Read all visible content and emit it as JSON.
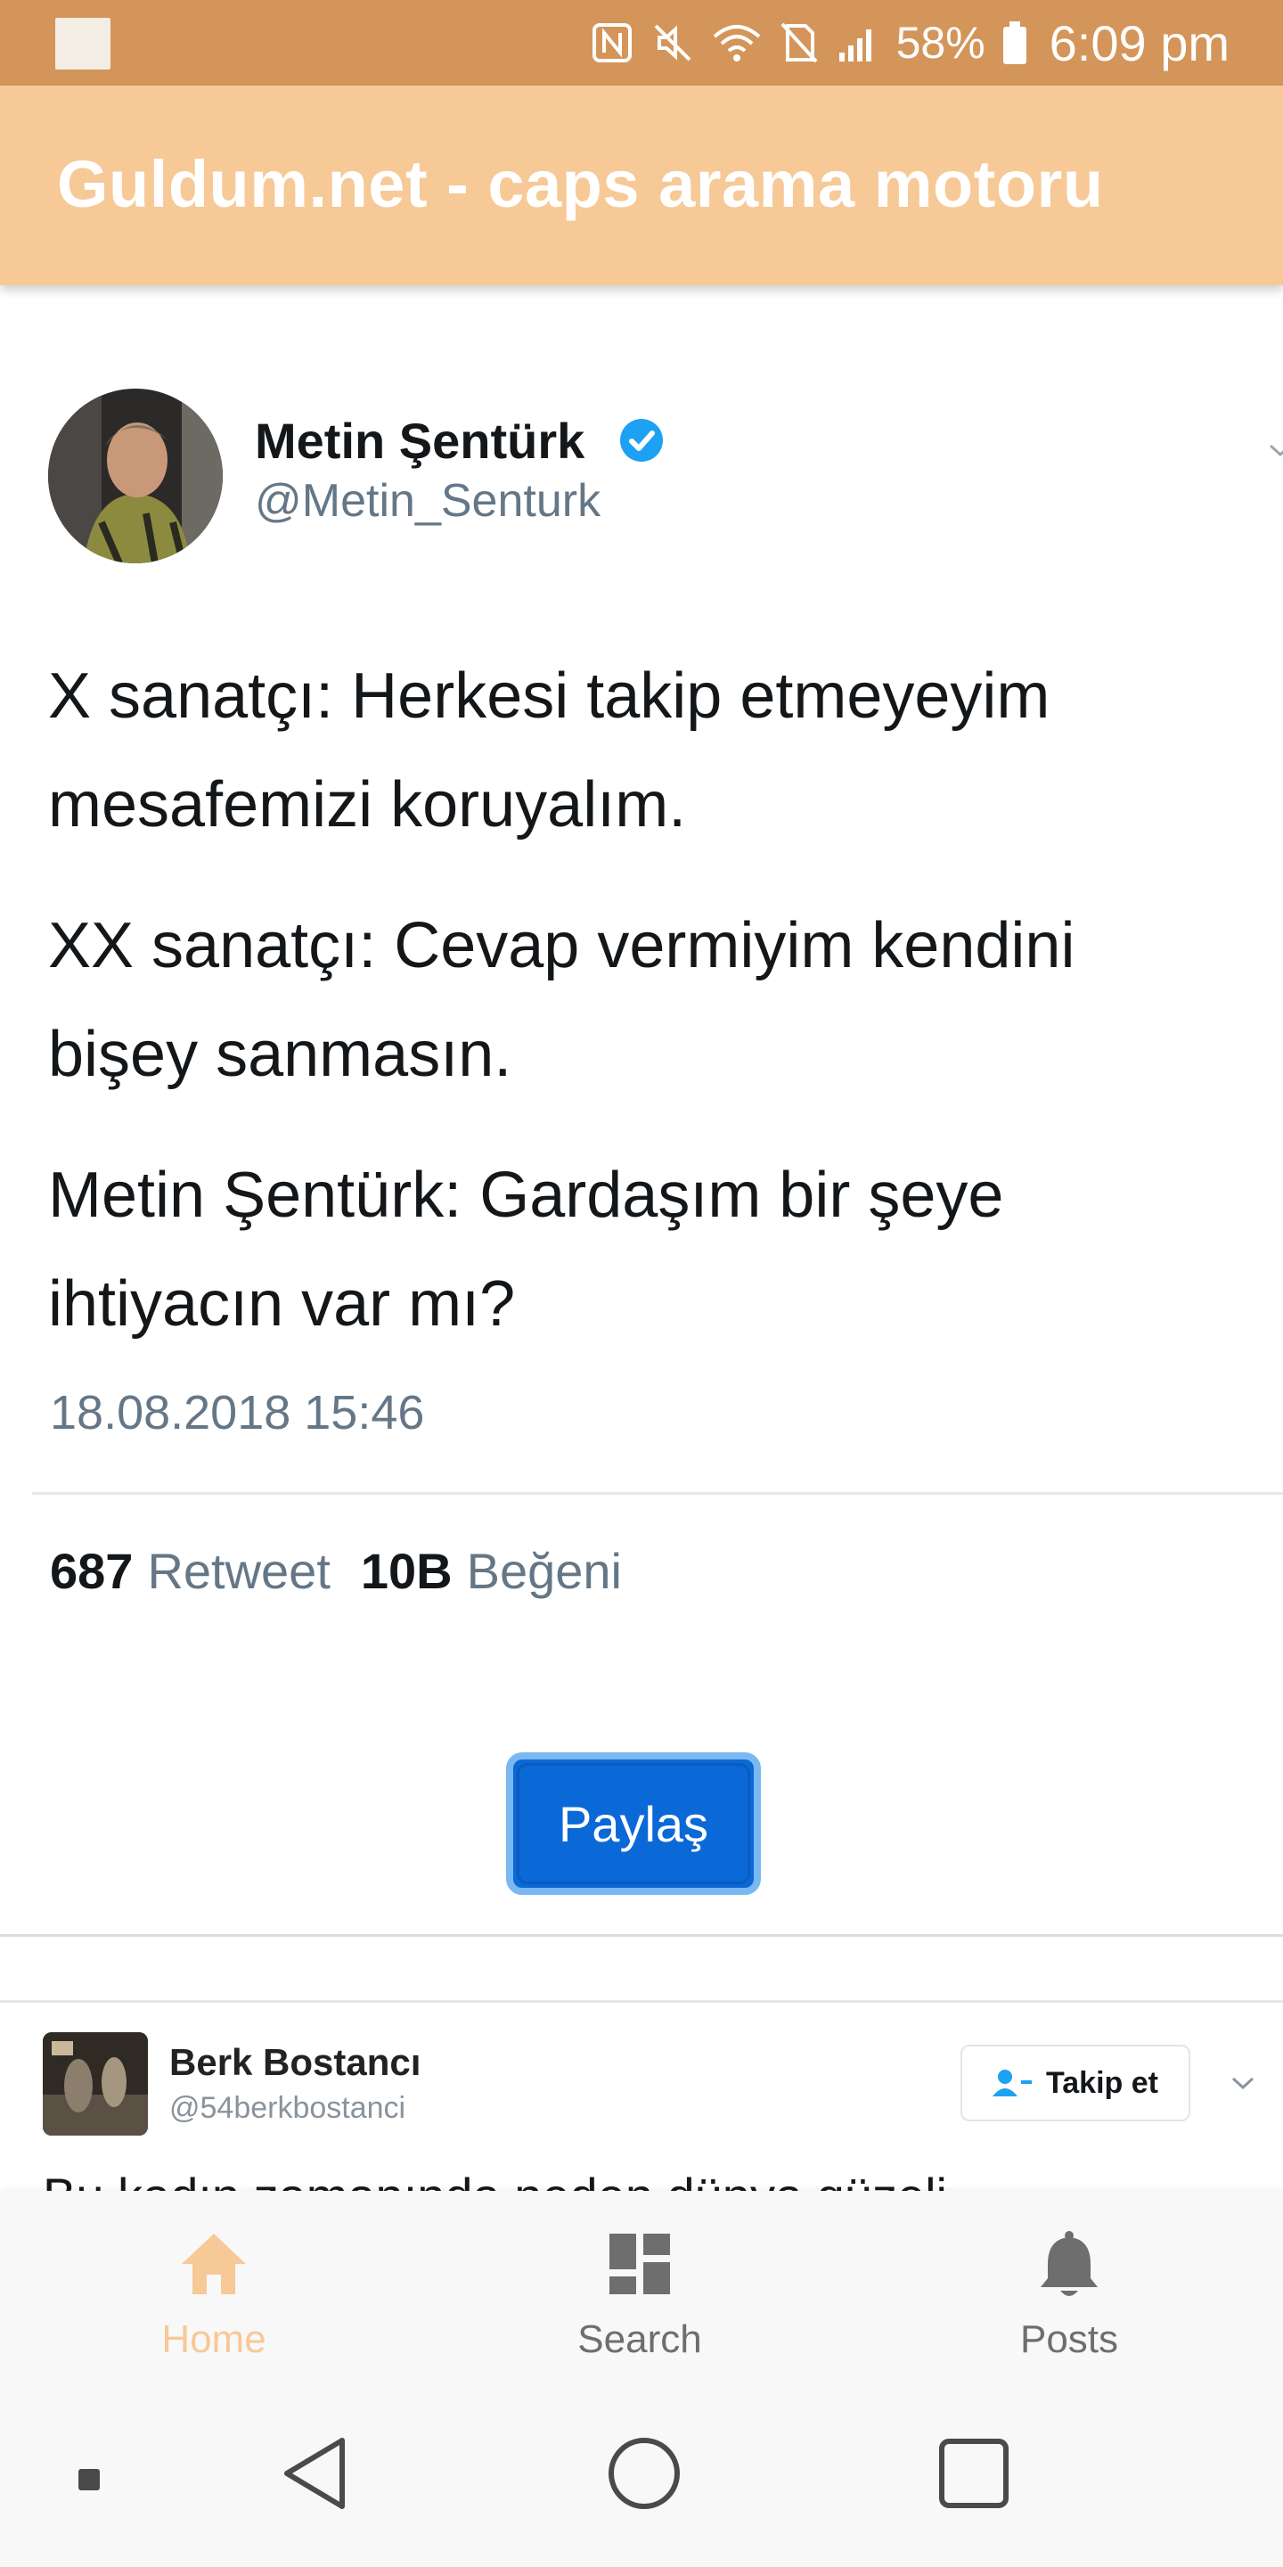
{
  "status_bar": {
    "battery": "58%",
    "time": "6:09 pm"
  },
  "app_header": {
    "title": "Guldum.net - caps arama motoru"
  },
  "tweet": {
    "author_name": "Metin Şentürk",
    "author_handle": "@Metin_Senturk",
    "lines": [
      "X sanatçı: Herkesi takip etmeyeyim",
      "mesafemizi koruyalım.",
      "XX sanatçı: Cevap vermiyim kendini",
      "bişey sanmasın.",
      "Metin Şentürk: Gardaşım bir şeye",
      "ihtiyacın var mı?"
    ],
    "timestamp": "18.08.2018 15:46",
    "retweet_count": "687",
    "retweet_label": "Retweet",
    "like_count": "10B",
    "like_label": "Beğeni"
  },
  "share_button": {
    "label": "Paylaş"
  },
  "second_tweet": {
    "author_name": "Berk Bostancı",
    "author_handle": "@54berkbostanci",
    "follow_label": "Takip et",
    "text_partial": "Bu kadın zamanında neden dünya güzeli"
  },
  "bottom_nav": {
    "items": [
      {
        "label": "Home",
        "icon": "home-icon",
        "active": true
      },
      {
        "label": "Search",
        "icon": "dashboard-icon",
        "active": false
      },
      {
        "label": "Posts",
        "icon": "bell-icon",
        "active": false
      }
    ]
  },
  "colors": {
    "status_bar": "#d4955a",
    "header": "#f6c997",
    "active_nav": "#f6c997",
    "share_button": "#0a69d6",
    "verified": "#1da1f2"
  }
}
